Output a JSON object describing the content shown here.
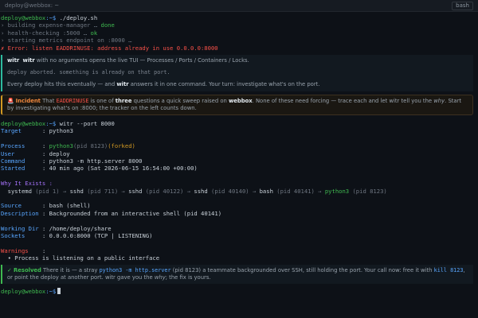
{
  "window": {
    "title": "deploy@webbox: ~",
    "tab": "bash"
  },
  "prompt": {
    "user_host": "deploy@webbox",
    "path": ":~$"
  },
  "deploy": {
    "command": "./deploy.sh",
    "l1_text": "› building expense-manager … ",
    "l1_status": "done",
    "l2_text": "› health-checking :5000 … ",
    "l2_status": "ok",
    "l3_text": "› starting metrics endpoint on :8000 …",
    "error": "✗ Error: listen EADDRINUSE: address already in use 0.0.0.0:8000"
  },
  "tip": {
    "cmd1": "witr",
    "cmd2": "witr",
    "line1_rest": " with no arguments opens the live TUI — Processes / Ports / Containers / Locks.",
    "line2": "deploy aborted. something is already on that port.",
    "line3_a": "Every deploy hits this eventually — and ",
    "line3_b": "witr",
    "line3_c": " answers it in one command. Your turn: investigate what's on the port."
  },
  "incident": {
    "icon": "🚨",
    "title": "Incident",
    "t1": " That ",
    "code1": "EADDRINUSE",
    "t2": " is one of ",
    "bold1": "three",
    "t3": " questions a quick sweep raised on ",
    "bold2": "webbox",
    "t4": ". None of these need forcing — trace each and let witr tell you the ",
    "em1": "why",
    "t5": ". Start by investigating what's on :8000; the tracker on the left counts down."
  },
  "witr": {
    "command": "witr --port 8000",
    "target_label": "Target",
    "target_value": "python3",
    "process_label": "Process",
    "process_name": "python3",
    "process_pid": "(pid 8123)",
    "process_flag": "(forked)",
    "user_label": "User",
    "user_value": "deploy",
    "command_label": "Command",
    "command_value": "python3 -m http.server 8000",
    "started_label": "Started",
    "started_value": "40 min ago (Sat 2026-06-15 16:54:00 +00:00)",
    "why_label": "Why It Exists :",
    "chain": [
      {
        "name": "systemd",
        "pid": "(pid 1)"
      },
      {
        "name": "sshd",
        "pid": "(pid 711)"
      },
      {
        "name": "sshd",
        "pid": "(pid 40122)"
      },
      {
        "name": "sshd",
        "pid": "(pid 40140)"
      },
      {
        "name": "bash",
        "pid": "(pid 40141)"
      },
      {
        "name": "python3",
        "pid": "(pid 8123)"
      }
    ],
    "arrow": " → ",
    "source_label": "Source",
    "source_value": "bash (shell)",
    "desc_label": "Description",
    "desc_value": "Backgrounded from an interactive shell (pid 40141)",
    "wd_label": "Working Dir",
    "wd_value": "/home/deploy/share",
    "sockets_label": "Sockets",
    "sockets_value": "0.0.0.0:8000 (TCP | LISTENING)",
    "warnings_label": "Warnings",
    "warning_item": "• Process is listening on a public interface"
  },
  "resolved": {
    "title": "✓ Resolved",
    "t1": " There it is — a stray ",
    "code1": "python3 -m http.server",
    "t2": " (pid 8123) a teammate backgrounded over SSH, still holding the port. Your call now: free it with ",
    "code2": "kill 8123",
    "t3": ", or point the deploy at another port. witr gave you the ",
    "em1": "why",
    "t4": "; the fix is yours."
  },
  "colors": {
    "prompt": "#3fb950",
    "path": "#58a6ff",
    "error": "#f85149",
    "accent": "#2dba9e",
    "warning": "#d29922"
  }
}
